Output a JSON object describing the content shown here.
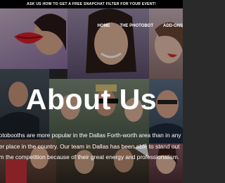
{
  "announcement": {
    "text": "ASK US HOW TO GET A FREE SNAPCHAT FILTER FOR YOUR EVENT!"
  },
  "nav": {
    "items": [
      {
        "label": "HOME"
      },
      {
        "label": "THE PHOTOBOT"
      },
      {
        "label": "ADD-ONS"
      }
    ]
  },
  "hero": {
    "title": "About Us",
    "paragraph_lines": [
      "hotobooths are more popular in the Dallas Forth-worth area than in any",
      "her place in the country. Our team in Dallas has been able to stand out",
      "om the competition because of their great energy and professionalism."
    ]
  },
  "colors": {
    "tile_purple": "#8a6fa0",
    "tile_warm": "#b8806a",
    "tile_dark": "#3c4a55",
    "tile_blue": "#4f6b8a",
    "tile_green": "#5a7a4a",
    "tile_red": "#c8323c"
  }
}
